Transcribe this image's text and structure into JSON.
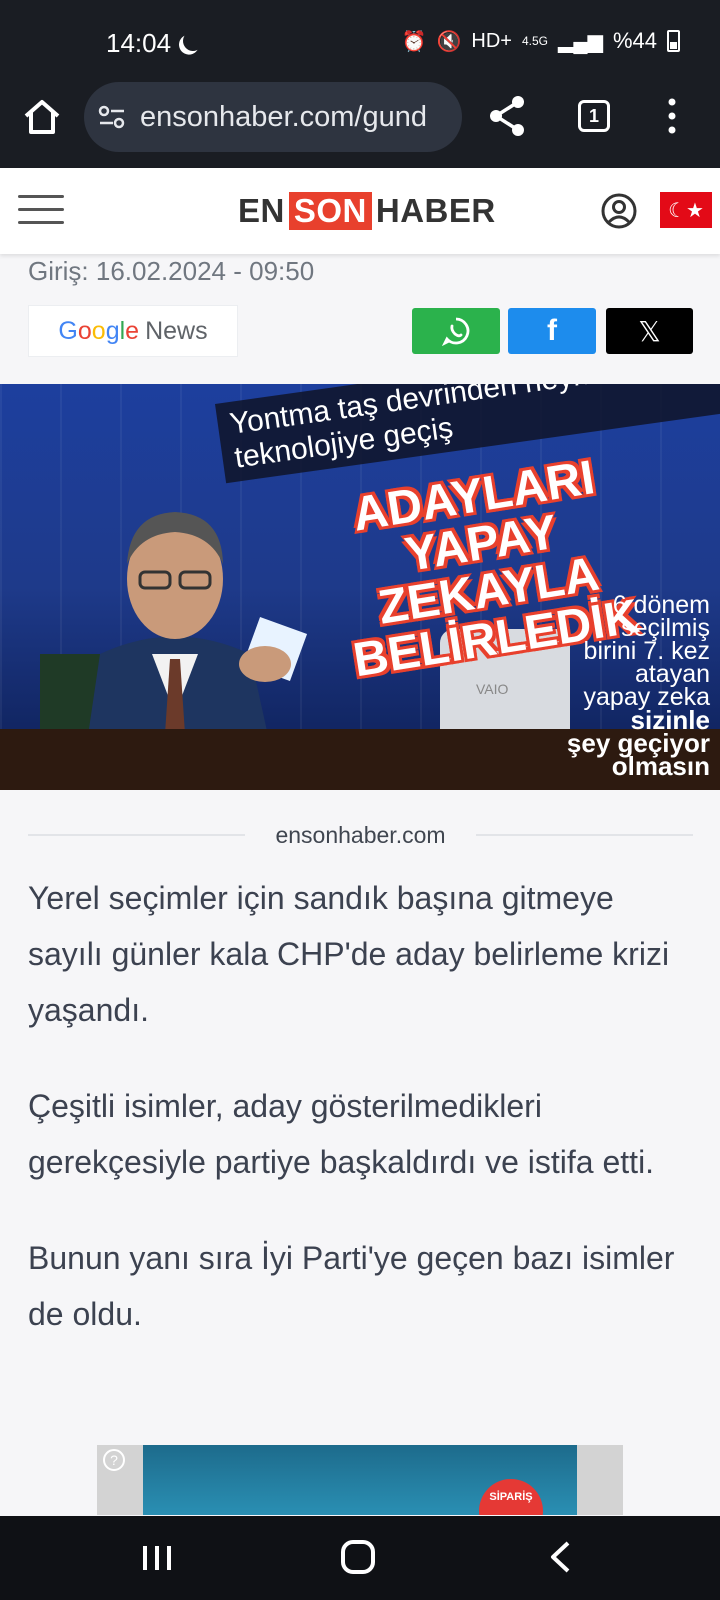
{
  "status_bar": {
    "time": "14:04",
    "battery": "%44",
    "network": "4.5G"
  },
  "browser": {
    "url": "ensonhaber.com/gund",
    "tab_count": "1"
  },
  "site": {
    "logo_en": "EN",
    "logo_son": "SON",
    "logo_haber": "HABER",
    "flag_symbol": "☾★"
  },
  "article_meta": {
    "date": "Giriş: 16.02.2024 - 09:50"
  },
  "google_news": {
    "g": "G",
    "o1": "o",
    "o2": "o",
    "g2": "g",
    "l": "l",
    "e": "e",
    "news": "News"
  },
  "share": {
    "whatsapp": "whatsapp-icon",
    "facebook": "f",
    "x": "𝕏"
  },
  "hero": {
    "caption": "Yontma taş devrinden heykelcilikten teknolojiye geçiş",
    "headline": "ADAYLARI YAPAY ZEKAYLA BELİRLEDİK",
    "side_lines": [
      "6 dönem",
      "seçilmiş",
      "birini 7. kez",
      "atayan",
      "yapay zeka"
    ],
    "side_bold": [
      "sizinle",
      "şey geçiyor",
      "olmasın"
    ],
    "monitor_brand": "VAIO"
  },
  "source": "ensonhaber.com",
  "paragraphs": [
    "Yerel seçimler için sandık başına gitmeye sayılı günler kala CHP'de aday belirleme krizi yaşandı.",
    "Çeşitli isimler, aday gösterilmedikleri gerekçesiyle partiye başkaldırdı ve istifa etti.",
    "Bunun yanı sıra İyi Parti'ye geçen bazı isimler de oldu."
  ],
  "ad": {
    "help": "?",
    "badge": "SİPARİŞ"
  },
  "colors": {
    "brand_red": "#e8402d",
    "whatsapp": "#2bb24c",
    "facebook": "#1d8ced",
    "x": "#000000"
  }
}
